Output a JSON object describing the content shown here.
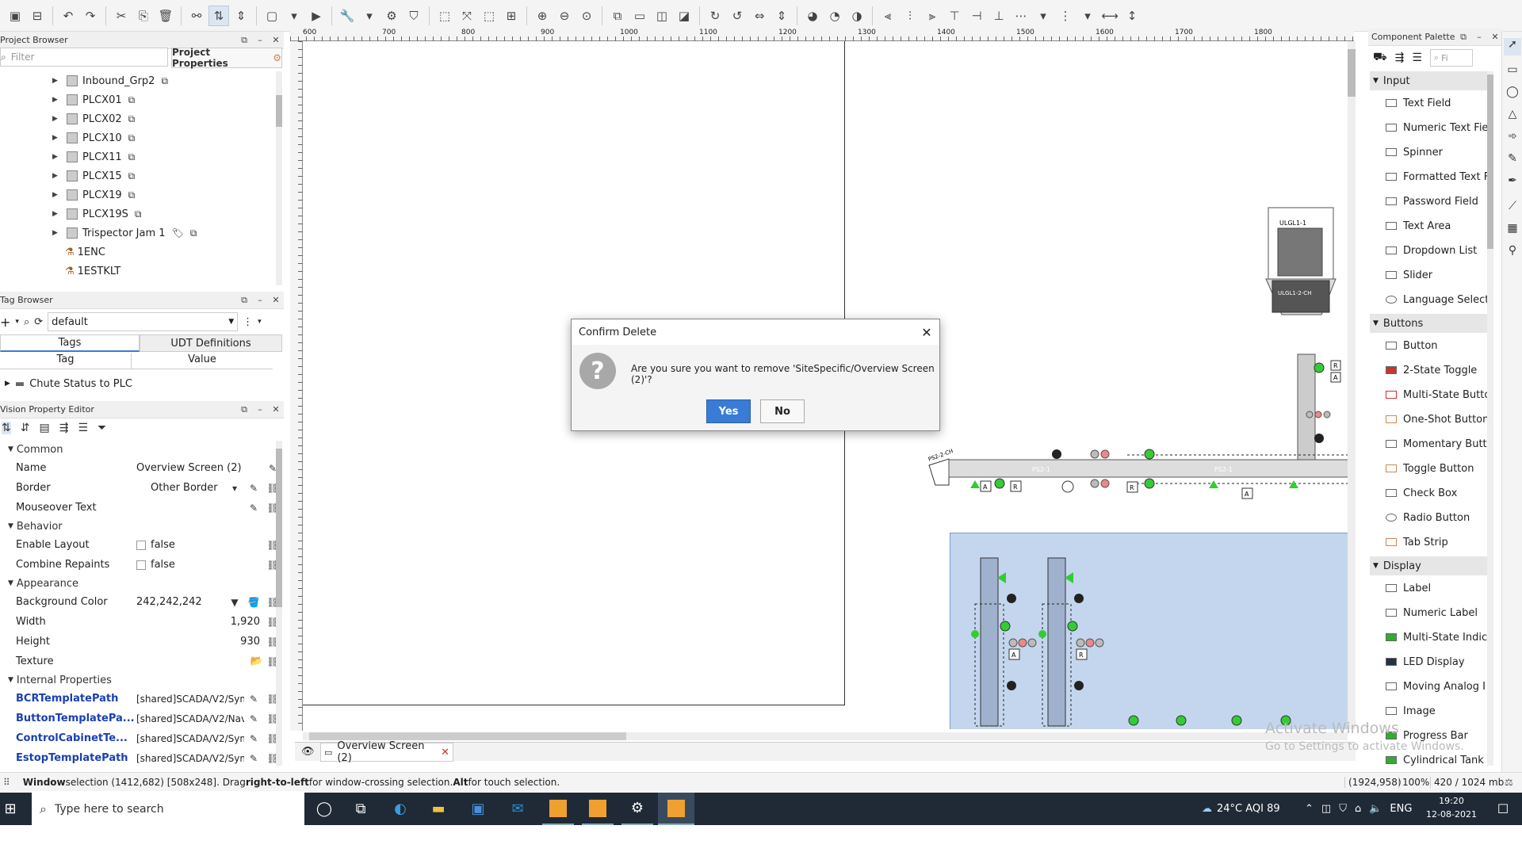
{
  "project_browser": {
    "title": "Project Browser",
    "filter_placeholder": "Filter",
    "properties_label": "Project Properties",
    "items": [
      {
        "label": "Inbound_Grp2"
      },
      {
        "label": "PLCX01"
      },
      {
        "label": "PLCX02"
      },
      {
        "label": "PLCX10"
      },
      {
        "label": "PLCX11"
      },
      {
        "label": "PLCX15"
      },
      {
        "label": "PLCX19"
      },
      {
        "label": "PLCX19S"
      },
      {
        "label": "Trispector Jam 1"
      },
      {
        "label": "1ENC"
      },
      {
        "label": "1ESTKLT"
      }
    ]
  },
  "tag_browser": {
    "title": "Tag Browser",
    "provider": "default",
    "tabs": [
      "Tags",
      "UDT Definitions"
    ],
    "col_tag": "Tag",
    "col_value": "Value",
    "row": "Chute Status to PLC"
  },
  "property_editor": {
    "title": "Vision Property Editor",
    "sections": {
      "common": "Common",
      "behavior": "Behavior",
      "appearance": "Appearance",
      "internal": "Internal Properties"
    },
    "rows": {
      "name_k": "Name",
      "name_v": "Overview Screen (2)",
      "border_k": "Border",
      "border_v": "Other Border",
      "mouse_k": "Mouseover Text",
      "enable_k": "Enable Layout",
      "enable_v": "false",
      "combine_k": "Combine Repaints",
      "combine_v": "false",
      "bg_k": "Background Color",
      "bg_v": "242,242,242",
      "width_k": "Width",
      "width_v": "1,920",
      "height_k": "Height",
      "height_v": "930",
      "texture_k": "Texture",
      "bcr_k": "BCRTemplatePath",
      "bcr_v": "[shared]SCADA/V2/Sym",
      "btn_k": "ButtonTemplatePa...",
      "btn_v": "[shared]SCADA/V2/Nav",
      "cc_k": "ControlCabinetTe...",
      "cc_v": "[shared]SCADA/V2/Sym",
      "es_k": "EstopTemplatePath",
      "es_v": "[shared]SCADA/V2/Sym"
    }
  },
  "ruler": {
    "marks": [
      "600",
      "700",
      "800",
      "900",
      "1000",
      "1100",
      "1200",
      "1300",
      "1400",
      "1500",
      "1600",
      "1700",
      "1800"
    ]
  },
  "diagram": {
    "labels": [
      "ULGL1-1",
      "ULGL1-2-CH",
      "PS2-1",
      "PS2-1",
      "PS2-2-CH",
      "A",
      "A",
      "R",
      "R",
      "A",
      "R",
      "A",
      "R",
      "R"
    ]
  },
  "dialog": {
    "title": "Confirm Delete",
    "message": "Are you sure you want to remove 'SiteSpecific/Overview Screen (2)'?",
    "yes": "Yes",
    "no": "No"
  },
  "tab": {
    "label": "Overview Screen (2)"
  },
  "palette": {
    "title": "Component Palette",
    "search_placeholder": "Fi",
    "sections": {
      "input": "Input",
      "buttons": "Buttons",
      "display": "Display"
    },
    "input": [
      "Text Field",
      "Numeric Text Fie",
      "Spinner",
      "Formatted Text F",
      "Password Field",
      "Text Area",
      "Dropdown List",
      "Slider",
      "Language Select"
    ],
    "buttons": [
      "Button",
      "2-State Toggle",
      "Multi-State Butto",
      "One-Shot Button",
      "Momentary Butto",
      "Toggle Button",
      "Check Box",
      "Radio Button",
      "Tab Strip"
    ],
    "display": [
      "Label",
      "Numeric Label",
      "Multi-State Indic",
      "LED Display",
      "Moving Analog I",
      "Image",
      "Progress Bar",
      "Cylindrical Tank"
    ]
  },
  "watermark": {
    "line1": "Activate Windows",
    "line2": "Go to Settings to activate Windows."
  },
  "status": {
    "w1": "Window",
    "t1": " selection (1412,682) [508x248]. Drag ",
    "w2": "right-to-left",
    "t2": " for window-crossing selection. ",
    "w3": "Alt",
    "t3": " for touch selection.",
    "coords": "(1924,958)",
    "zoom": "100%",
    "mem": "420 / 1024 mb"
  },
  "taskbar": {
    "search": "Type here to search",
    "weather": "24°C  AQI 89",
    "lang": "ENG",
    "time": "19:20",
    "date": "12-08-2021"
  }
}
